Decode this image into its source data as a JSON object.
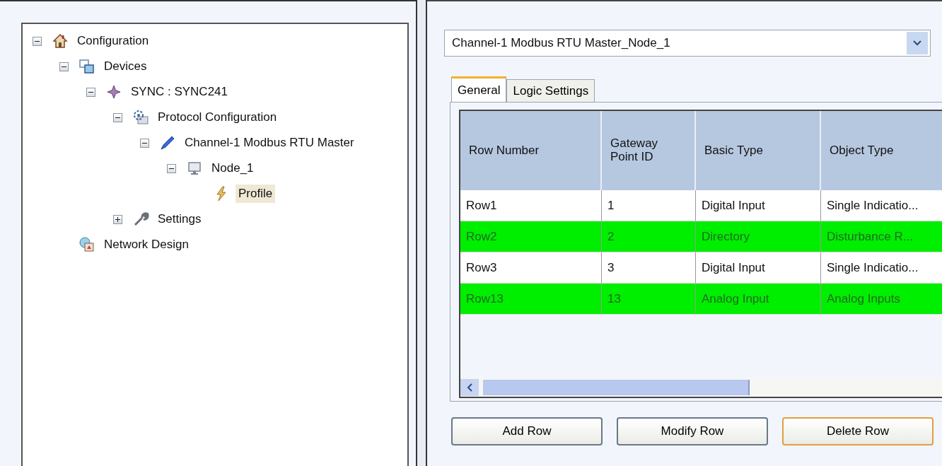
{
  "tree": [
    {
      "label": "Configuration",
      "kind": "home",
      "expanded": true,
      "selected": false,
      "children": [
        {
          "label": "Devices",
          "kind": "devices",
          "expanded": true,
          "selected": false,
          "children": [
            {
              "label": "SYNC : SYNC241",
              "kind": "device",
              "expanded": true,
              "selected": false,
              "children": [
                {
                  "label": "Protocol Configuration",
                  "kind": "protocol",
                  "expanded": true,
                  "selected": false,
                  "children": [
                    {
                      "label": "Channel-1 Modbus RTU Master",
                      "kind": "channel",
                      "expanded": true,
                      "selected": false,
                      "children": [
                        {
                          "label": "Node_1",
                          "kind": "node",
                          "expanded": true,
                          "selected": false,
                          "children": [
                            {
                              "label": "Profile",
                              "kind": "profile",
                              "selected": true
                            }
                          ]
                        }
                      ]
                    }
                  ]
                },
                {
                  "label": "Settings",
                  "kind": "settings",
                  "expanded": false,
                  "selected": false
                }
              ]
            }
          ]
        },
        {
          "label": "Network Design",
          "kind": "network",
          "selected": false
        }
      ]
    }
  ],
  "dropdown": {
    "value": "Channel-1 Modbus RTU Master_Node_1"
  },
  "tabs": [
    {
      "label": "General",
      "selected": true
    },
    {
      "label": "Logic Settings",
      "selected": false
    }
  ],
  "table": {
    "columns": [
      "Row Number",
      "Gateway Point ID",
      "Basic Type",
      "Object Type"
    ],
    "rows": [
      {
        "cells": [
          "Row1",
          "1",
          "Digital Input",
          "Single Indicatio..."
        ],
        "color": "#ffffff"
      },
      {
        "cells": [
          "Row2",
          "2",
          "Directory",
          "Disturbance R..."
        ],
        "color": "#00ee00"
      },
      {
        "cells": [
          "Row3",
          "3",
          "Digital Input",
          "Single Indicatio..."
        ],
        "color": "#ffffff"
      },
      {
        "cells": [
          "Row13",
          "13",
          "Analog Input",
          "Analog Inputs"
        ],
        "color": "#00ee00"
      }
    ]
  },
  "buttons": [
    {
      "label": "Add Row",
      "default": false
    },
    {
      "label": "Modify Row",
      "default": false
    },
    {
      "label": "Delete Row",
      "default": true
    }
  ]
}
